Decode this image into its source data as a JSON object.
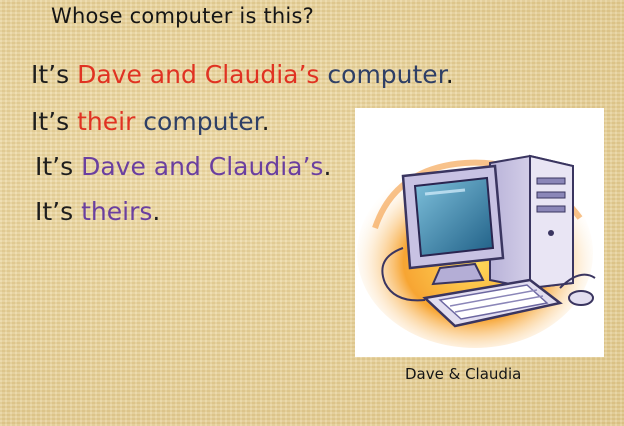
{
  "question": "Whose computer is this?",
  "lines": [
    {
      "prefix": "It’s ",
      "highlight": "Dave and Claudia’s",
      "suffix": " computer",
      "end": "."
    },
    {
      "prefix": "It’s ",
      "highlight": "their",
      "suffix": " computer",
      "end": "."
    },
    {
      "prefix": "It’s ",
      "highlight": "Dave and Claudia’s",
      "end": "."
    },
    {
      "prefix": "It’s ",
      "highlight": "theirs",
      "end": "."
    }
  ],
  "image": {
    "icon": "desktop-computer-icon"
  },
  "caption": "Dave & Claudia",
  "colors": {
    "red": "#e03222",
    "navy": "#2e3f66",
    "purple": "#6a3fa0",
    "background": "#e7d39c"
  }
}
